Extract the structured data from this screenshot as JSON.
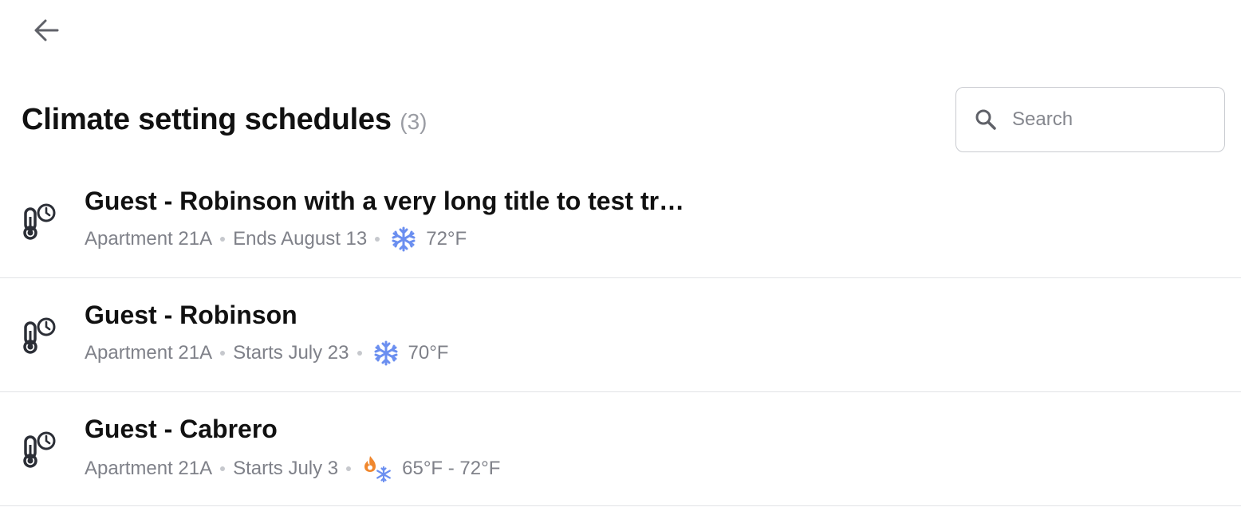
{
  "header": {
    "title": "Climate setting schedules",
    "count": "(3)"
  },
  "search": {
    "placeholder": "Search",
    "value": ""
  },
  "icons": {
    "back": "arrow-left-icon",
    "search": "search-icon",
    "row": "thermometer-clock-icon",
    "cool": "snowflake-icon",
    "heat_cool": "flame-snowflake-icon"
  },
  "colors": {
    "cool": "#6b8ff0",
    "heat": "#f0872d",
    "meta_text": "#7f8189",
    "divider": "#e2e3e6"
  },
  "schedules": [
    {
      "title": "Guest - Robinson with a very long title to test truncation",
      "location": "Apartment 21A",
      "timing": "Ends August 13",
      "mode": "cool",
      "temperature": "72°F"
    },
    {
      "title": "Guest - Robinson",
      "location": "Apartment 21A",
      "timing": "Starts July 23",
      "mode": "cool",
      "temperature": "70°F"
    },
    {
      "title": "Guest - Cabrero",
      "location": "Apartment 21A",
      "timing": "Starts July 3",
      "mode": "heat_cool",
      "temperature": "65°F - 72°F"
    }
  ]
}
